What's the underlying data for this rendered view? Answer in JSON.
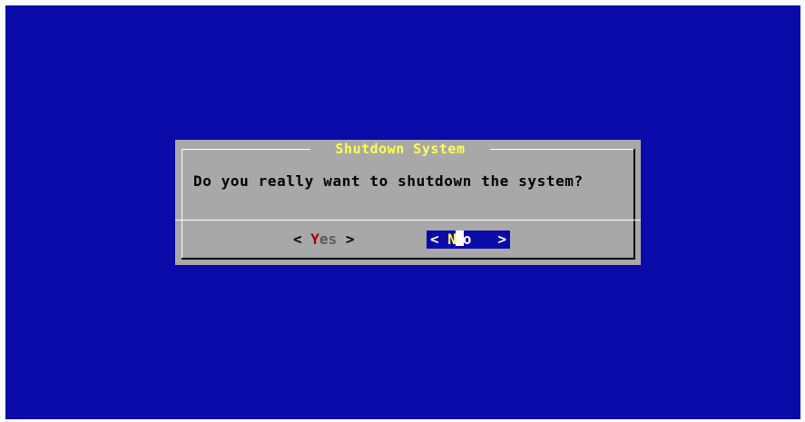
{
  "dialog": {
    "title": "Shutdown System",
    "message": "Do you really want to shutdown the system?",
    "buttons": {
      "yes": {
        "left_bracket": "<",
        "hotkey": "Y",
        "rest": "es",
        "right_bracket": ">"
      },
      "no": {
        "left_bracket": "<",
        "hotkey": "N",
        "rest": "o",
        "right_bracket": ">",
        "selected": true
      }
    }
  },
  "colors": {
    "background": "#0a0aa8",
    "dialog": "#a8a8a8",
    "title": "#ffff55",
    "hotkey_yes": "#a80000",
    "selected_button_bg": "#0a0aa8"
  }
}
